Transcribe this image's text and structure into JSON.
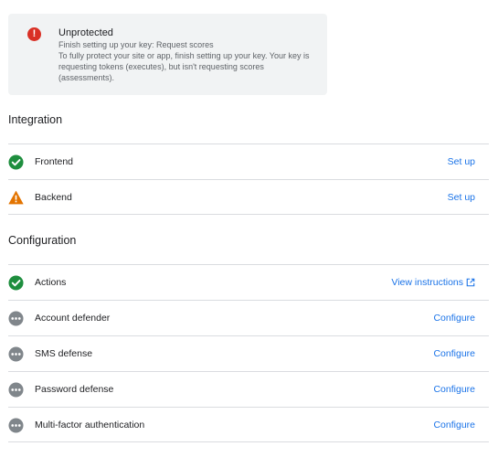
{
  "alert": {
    "title": "Unprotected",
    "line1": "Finish setting up your key: Request scores",
    "line2": "To fully protect your site or app, finish setting up your key. Your key is",
    "line3": "requesting tokens (executes), but isn't requesting scores",
    "line4": "(assessments).",
    "icon": "error-icon",
    "icon_glyph": "!",
    "color": "#d93025"
  },
  "integration": {
    "title": "Integration",
    "rows": [
      {
        "label": "Frontend",
        "status": "success",
        "icon": "check-circle-icon",
        "action": "Set up"
      },
      {
        "label": "Backend",
        "status": "warning",
        "icon": "warning-triangle-icon",
        "action": "Set up"
      }
    ]
  },
  "configuration": {
    "title": "Configuration",
    "rows": [
      {
        "label": "Actions",
        "status": "success",
        "icon": "check-circle-icon",
        "action": "View instructions",
        "action_icon": "open-in-new-icon"
      },
      {
        "label": "Account defender",
        "status": "pending",
        "icon": "more-horiz-circle-icon",
        "action": "Configure"
      },
      {
        "label": "SMS defense",
        "status": "pending",
        "icon": "more-horiz-circle-icon",
        "action": "Configure"
      },
      {
        "label": "Password defense",
        "status": "pending",
        "icon": "more-horiz-circle-icon",
        "action": "Configure"
      },
      {
        "label": "Multi-factor authentication",
        "status": "pending",
        "icon": "more-horiz-circle-icon",
        "action": "Configure"
      }
    ]
  },
  "colors": {
    "success": "#1e8e3e",
    "warning": "#e37400",
    "pending": "#80868b",
    "link": "#1a73e8"
  }
}
